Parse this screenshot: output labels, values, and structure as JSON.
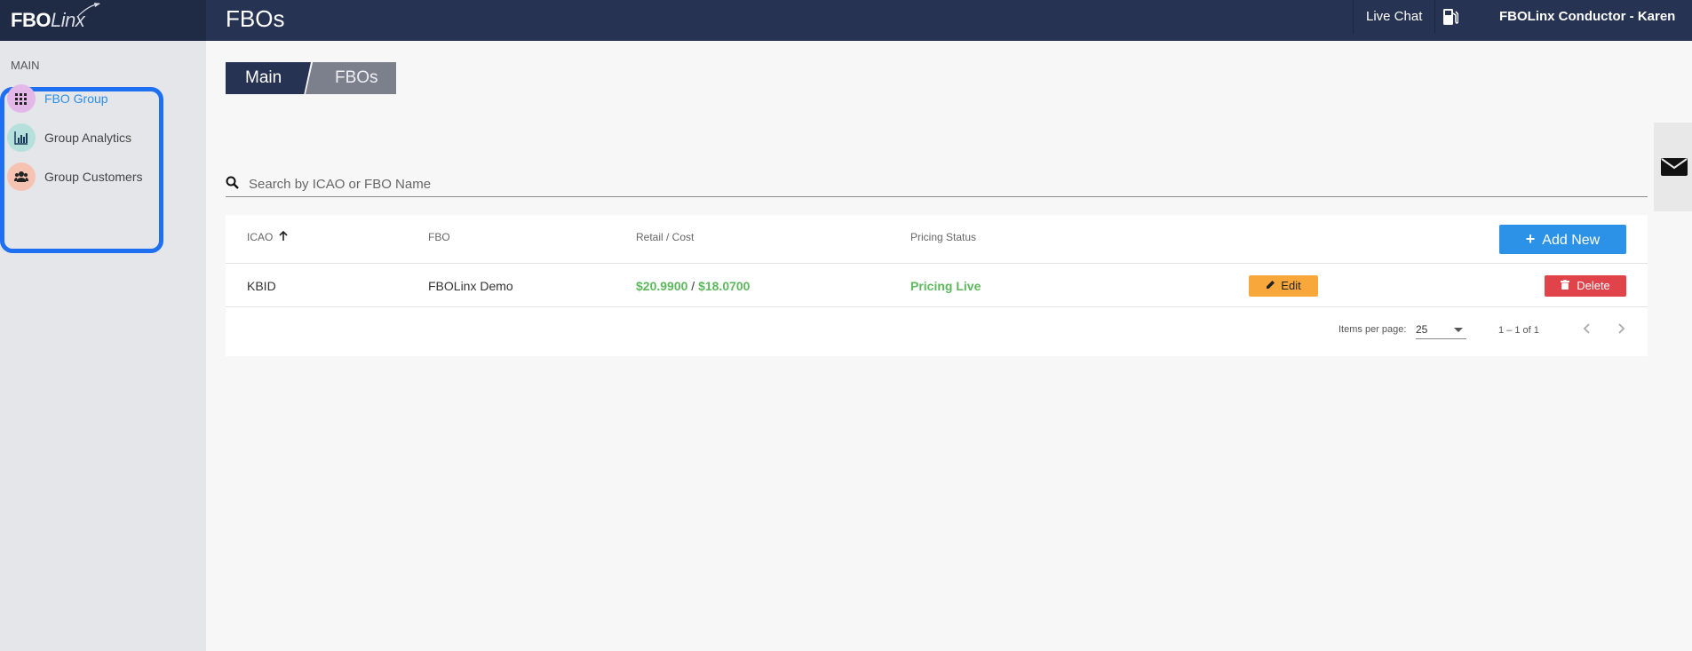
{
  "app": {
    "logo_bold": "FBO",
    "logo_italic": "Linx",
    "page_title": "FBOs",
    "live_chat": "Live Chat",
    "user_name": "FBOLinx Conductor - Karen"
  },
  "sidebar": {
    "section": "MAIN",
    "items": [
      {
        "label": "FBO Group",
        "icon": "grid-icon",
        "icon_bg": "#e3b8e8",
        "active": true
      },
      {
        "label": "Group Analytics",
        "icon": "bar-chart-icon",
        "icon_bg": "#b5e0dc",
        "active": false
      },
      {
        "label": "Group Customers",
        "icon": "users-icon",
        "icon_bg": "#f6c3b3",
        "active": false
      }
    ]
  },
  "breadcrumb": {
    "main": "Main",
    "current": "FBOs"
  },
  "search": {
    "placeholder": "Search by ICAO or FBO Name"
  },
  "table": {
    "columns": {
      "icao": "ICAO",
      "fbo": "FBO",
      "retail_cost": "Retail / Cost",
      "pricing_status": "Pricing Status"
    },
    "add_new_label": "Add New",
    "rows": [
      {
        "icao": "KBID",
        "fbo": "FBOLinx Demo",
        "retail": "$20.9900",
        "separator": " / ",
        "cost": "$18.0700",
        "status": "Pricing Live",
        "edit_label": "Edit",
        "delete_label": "Delete"
      }
    ]
  },
  "paginator": {
    "items_per_page_label": "Items per page:",
    "items_per_page": "25",
    "range": "1 – 1 of 1"
  },
  "colors": {
    "topbar": "#273353",
    "accent_blue": "#2b92e8",
    "edit_orange": "#f8a83a",
    "delete_red": "#e0434a",
    "status_green": "#5cb85c"
  }
}
